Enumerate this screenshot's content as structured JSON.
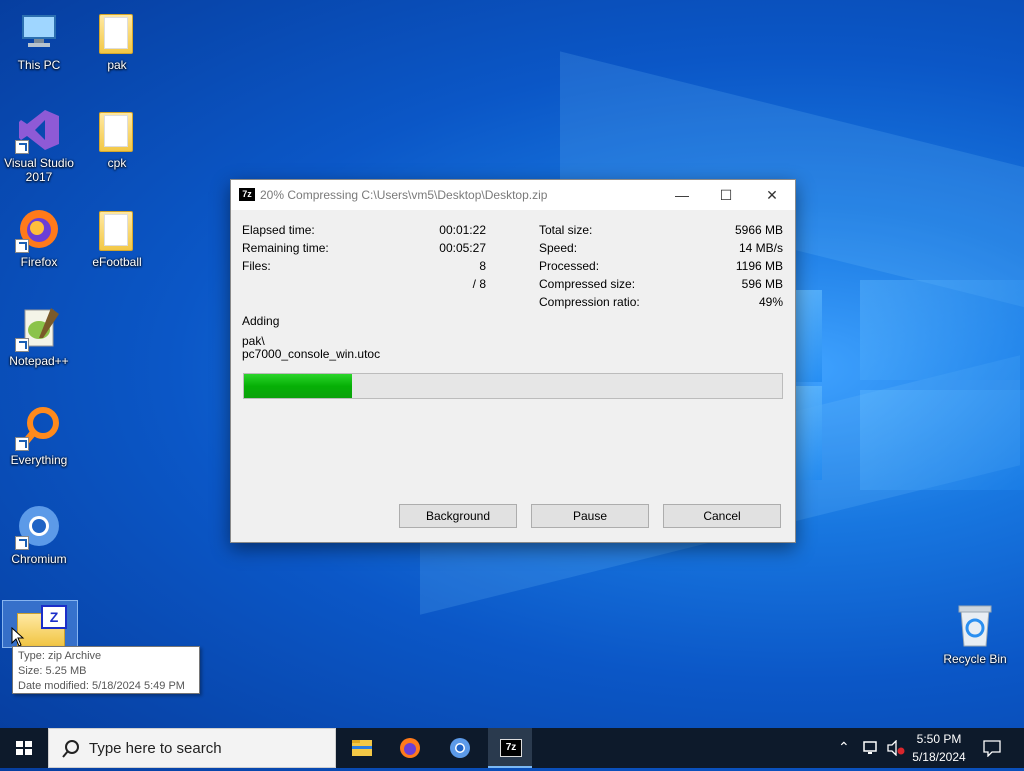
{
  "desktop": {
    "icons": [
      {
        "label": "This PC",
        "icon": "computer-icon"
      },
      {
        "label": "pak",
        "icon": "folder-icon"
      },
      {
        "label": "Visual Studio 2017",
        "icon": "visual-studio-icon"
      },
      {
        "label": "cpk",
        "icon": "folder-icon"
      },
      {
        "label": "Firefox",
        "icon": "firefox-icon"
      },
      {
        "label": "eFootball",
        "icon": "folder-icon"
      },
      {
        "label": "Notepad++",
        "icon": "notepadpp-icon"
      },
      {
        "label": "Everything",
        "icon": "everything-icon"
      },
      {
        "label": "Chromium",
        "icon": "chromium-icon"
      },
      {
        "label": "Recycle Bin",
        "icon": "recycle-bin-icon"
      }
    ]
  },
  "tooltip": {
    "line1": "Type: zip Archive",
    "line2": "Size: 5.25 MB",
    "line3": "Date modified: 5/18/2024 5:49 PM"
  },
  "dialog": {
    "app_icon": "7z",
    "title": "20% Compressing C:\\Users\\vm5\\Desktop\\Desktop.zip",
    "left_stats": [
      {
        "label": "Elapsed time:",
        "value": "00:01:22"
      },
      {
        "label": "Remaining time:",
        "value": "00:05:27"
      },
      {
        "label": "Files:",
        "value": "8"
      },
      {
        "label": "",
        "value": "/ 8"
      }
    ],
    "right_stats": [
      {
        "label": "Total size:",
        "value": "5966 MB"
      },
      {
        "label": "Speed:",
        "value": "14 MB/s"
      },
      {
        "label": "Processed:",
        "value": "1196 MB"
      },
      {
        "label": "Compressed size:",
        "value": "596 MB"
      },
      {
        "label": "Compression ratio:",
        "value": "49%"
      }
    ],
    "status": "Adding",
    "current_path": "pak\\",
    "current_file": "pc7000_console_win.utoc",
    "progress_fraction": 0.2,
    "buttons": {
      "background": "Background",
      "pause": "Pause",
      "cancel": "Cancel"
    }
  },
  "taskbar": {
    "search_placeholder": "Type here to search",
    "time": "5:50 PM",
    "date": "5/18/2024"
  },
  "colors": {
    "progress": "#06b006",
    "taskbar": "#0d1a2b"
  }
}
